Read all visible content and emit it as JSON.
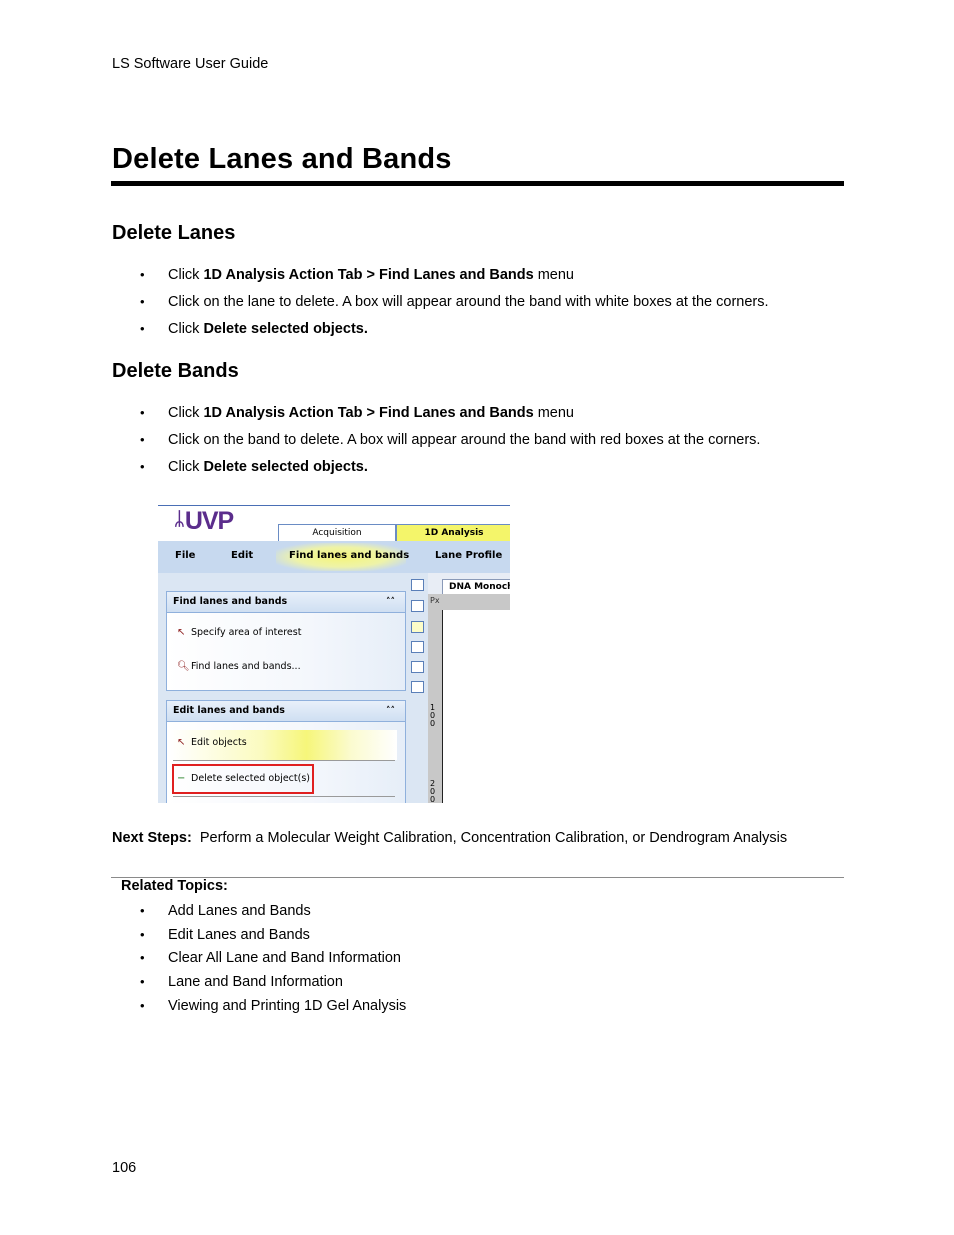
{
  "running_header": "LS Software User Guide",
  "page_title": "Delete Lanes and Bands",
  "sections": [
    {
      "heading": "Delete Lanes",
      "steps": [
        {
          "prefix": "Click ",
          "bold": "1D Analysis Action Tab > Find Lanes and Bands",
          "suffix": " menu"
        },
        {
          "prefix": "Click on the lane to delete. A box will appear around the band with white boxes at the corners.",
          "bold": "",
          "suffix": ""
        },
        {
          "prefix": "Click ",
          "bold": "Delete selected objects.",
          "suffix": ""
        }
      ]
    },
    {
      "heading": "Delete Bands",
      "steps": [
        {
          "prefix": "Click ",
          "bold": "1D Analysis Action Tab > Find Lanes and Bands",
          "suffix": " menu"
        },
        {
          "prefix": "Click on the band to delete. A box will appear around the band with red boxes at the corners.",
          "bold": "",
          "suffix": ""
        },
        {
          "prefix": "Click ",
          "bold": "Delete selected objects.",
          "suffix": ""
        }
      ]
    }
  ],
  "screenshot": {
    "logo": "UVP",
    "tabs": [
      "Acquisition",
      "1D Analysis"
    ],
    "active_tab": "1D Analysis",
    "menu": [
      "File",
      "Edit",
      "Find lanes and bands",
      "Lane Profile"
    ],
    "active_menu": "Find lanes and bands",
    "panels": [
      {
        "title": "Find lanes and bands",
        "items": [
          "Specify area of interest",
          "Find lanes and bands..."
        ]
      },
      {
        "title": "Edit lanes and bands",
        "items": [
          "Edit objects",
          "Delete selected object(s)"
        ]
      }
    ],
    "collapse_glyph": "˄˄",
    "image_tab": "DNA Monochrome",
    "ruler_unit": "Px",
    "ruler_labels": [
      "100",
      "200"
    ],
    "highlight_color": "#e02020"
  },
  "next_steps": {
    "label": "Next Steps:",
    "text": "Perform a Molecular Weight Calibration, Concentration Calibration, or Dendrogram Analysis"
  },
  "related_topics": {
    "title": "Related Topics:",
    "items": [
      "Add Lanes and Bands",
      "Edit Lanes and Bands",
      "Clear All Lane and Band Information",
      "Lane and Band Information",
      "Viewing and Printing 1D Gel Analysis"
    ]
  },
  "page_number": "106"
}
